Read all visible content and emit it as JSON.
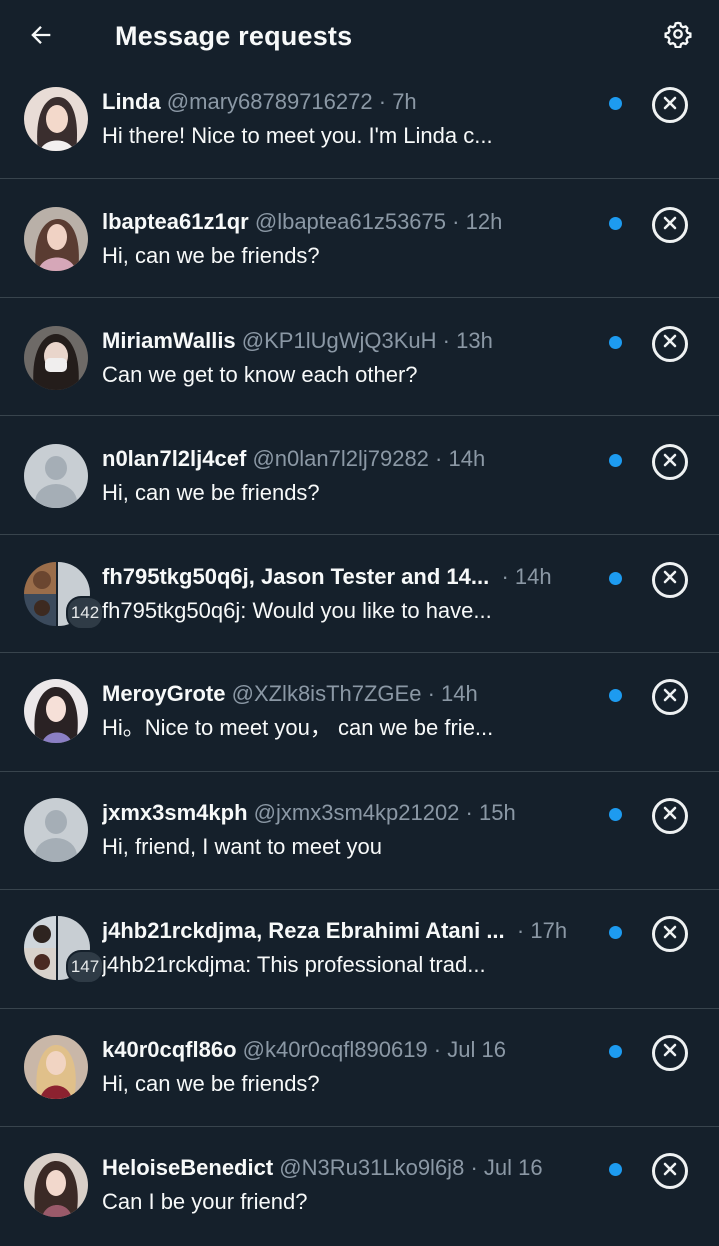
{
  "header": {
    "title": "Message requests",
    "back_icon": "arrow-left-icon",
    "settings_icon": "gear-icon"
  },
  "requests": [
    {
      "name": "Linda",
      "handle": "@mary68789716272",
      "time": "7h",
      "message": "Hi there! Nice to meet you. I'm Linda c...",
      "avatar": "photo"
    },
    {
      "name": "lbaptea61z1qr",
      "handle": "@lbaptea61z53675",
      "time": "12h",
      "message": "Hi, can we be friends?",
      "avatar": "photo"
    },
    {
      "name": "MiriamWallis",
      "handle": "@KP1lUgWjQ3KuH",
      "time": "13h",
      "message": "Can we get to know each other?",
      "avatar": "photo"
    },
    {
      "name": "n0lan7l2lj4cef",
      "handle": "@n0lan7l2lj79282",
      "time": "14h",
      "message": "Hi, can we be friends?",
      "avatar": "default"
    },
    {
      "name": "fh795tkg50q6j, Jason Tester and 14...",
      "handle": "",
      "time": "14h",
      "message": "fh795tkg50q6j: Would you like to have...",
      "avatar": "group",
      "badge": "142"
    },
    {
      "name": "MeroyGrote",
      "handle": "@XZlk8isTh7ZGEe",
      "time": "14h",
      "message": "Hi。Nice to meet you， can we be frie...",
      "avatar": "photo"
    },
    {
      "name": "jxmx3sm4kph",
      "handle": "@jxmx3sm4kp21202",
      "time": "15h",
      "message": "Hi, friend, I want to meet you",
      "avatar": "default"
    },
    {
      "name": "j4hb21rckdjma, Reza Ebrahimi Atani ...",
      "handle": "",
      "time": "17h",
      "message": "j4hb21rckdjma: This professional trad...",
      "avatar": "group",
      "badge": "147"
    },
    {
      "name": "k40r0cqfl86o",
      "handle": "@k40r0cqfl890619",
      "time": "Jul 16",
      "message": "Hi, can we be friends?",
      "avatar": "photo"
    },
    {
      "name": "HeloiseBenedict",
      "handle": "@N3Ru31Lko9l6j8",
      "time": "Jul 16",
      "message": "Can I be your friend?",
      "avatar": "photo"
    }
  ],
  "colors": {
    "background": "#15202b",
    "accent": "#1d9bf0",
    "muted": "#8b98a5",
    "divider": "#38444d"
  }
}
